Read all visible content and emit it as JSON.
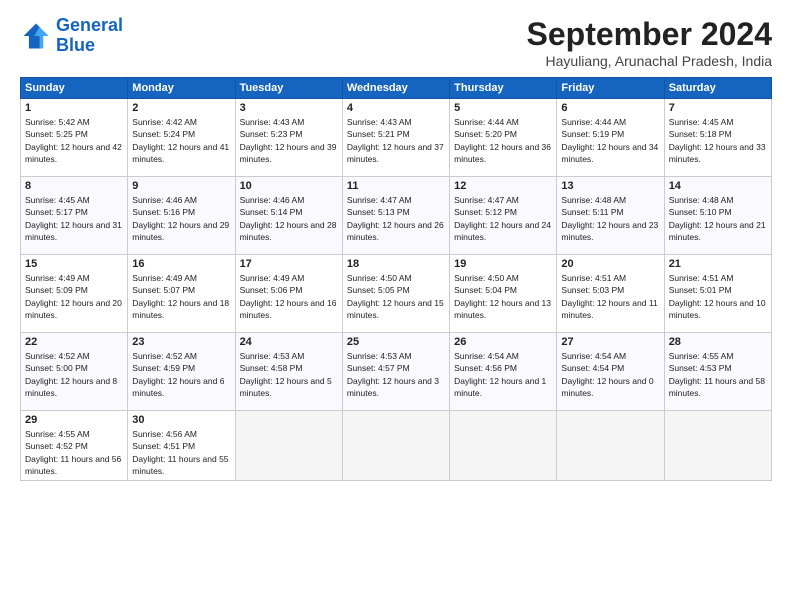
{
  "logo": {
    "line1": "General",
    "line2": "Blue"
  },
  "title": "September 2024",
  "location": "Hayuliang, Arunachal Pradesh, India",
  "days_of_week": [
    "Sunday",
    "Monday",
    "Tuesday",
    "Wednesday",
    "Thursday",
    "Friday",
    "Saturday"
  ],
  "weeks": [
    [
      {
        "num": "1",
        "sunrise": "5:42 AM",
        "sunset": "5:25 PM",
        "daylight": "12 hours and 42 minutes."
      },
      {
        "num": "2",
        "sunrise": "4:42 AM",
        "sunset": "5:24 PM",
        "daylight": "12 hours and 41 minutes."
      },
      {
        "num": "3",
        "sunrise": "4:43 AM",
        "sunset": "5:23 PM",
        "daylight": "12 hours and 39 minutes."
      },
      {
        "num": "4",
        "sunrise": "4:43 AM",
        "sunset": "5:21 PM",
        "daylight": "12 hours and 37 minutes."
      },
      {
        "num": "5",
        "sunrise": "4:44 AM",
        "sunset": "5:20 PM",
        "daylight": "12 hours and 36 minutes."
      },
      {
        "num": "6",
        "sunrise": "4:44 AM",
        "sunset": "5:19 PM",
        "daylight": "12 hours and 34 minutes."
      },
      {
        "num": "7",
        "sunrise": "4:45 AM",
        "sunset": "5:18 PM",
        "daylight": "12 hours and 33 minutes."
      }
    ],
    [
      {
        "num": "8",
        "sunrise": "4:45 AM",
        "sunset": "5:17 PM",
        "daylight": "12 hours and 31 minutes."
      },
      {
        "num": "9",
        "sunrise": "4:46 AM",
        "sunset": "5:16 PM",
        "daylight": "12 hours and 29 minutes."
      },
      {
        "num": "10",
        "sunrise": "4:46 AM",
        "sunset": "5:14 PM",
        "daylight": "12 hours and 28 minutes."
      },
      {
        "num": "11",
        "sunrise": "4:47 AM",
        "sunset": "5:13 PM",
        "daylight": "12 hours and 26 minutes."
      },
      {
        "num": "12",
        "sunrise": "4:47 AM",
        "sunset": "5:12 PM",
        "daylight": "12 hours and 24 minutes."
      },
      {
        "num": "13",
        "sunrise": "4:48 AM",
        "sunset": "5:11 PM",
        "daylight": "12 hours and 23 minutes."
      },
      {
        "num": "14",
        "sunrise": "4:48 AM",
        "sunset": "5:10 PM",
        "daylight": "12 hours and 21 minutes."
      }
    ],
    [
      {
        "num": "15",
        "sunrise": "4:49 AM",
        "sunset": "5:09 PM",
        "daylight": "12 hours and 20 minutes."
      },
      {
        "num": "16",
        "sunrise": "4:49 AM",
        "sunset": "5:07 PM",
        "daylight": "12 hours and 18 minutes."
      },
      {
        "num": "17",
        "sunrise": "4:49 AM",
        "sunset": "5:06 PM",
        "daylight": "12 hours and 16 minutes."
      },
      {
        "num": "18",
        "sunrise": "4:50 AM",
        "sunset": "5:05 PM",
        "daylight": "12 hours and 15 minutes."
      },
      {
        "num": "19",
        "sunrise": "4:50 AM",
        "sunset": "5:04 PM",
        "daylight": "12 hours and 13 minutes."
      },
      {
        "num": "20",
        "sunrise": "4:51 AM",
        "sunset": "5:03 PM",
        "daylight": "12 hours and 11 minutes."
      },
      {
        "num": "21",
        "sunrise": "4:51 AM",
        "sunset": "5:01 PM",
        "daylight": "12 hours and 10 minutes."
      }
    ],
    [
      {
        "num": "22",
        "sunrise": "4:52 AM",
        "sunset": "5:00 PM",
        "daylight": "12 hours and 8 minutes."
      },
      {
        "num": "23",
        "sunrise": "4:52 AM",
        "sunset": "4:59 PM",
        "daylight": "12 hours and 6 minutes."
      },
      {
        "num": "24",
        "sunrise": "4:53 AM",
        "sunset": "4:58 PM",
        "daylight": "12 hours and 5 minutes."
      },
      {
        "num": "25",
        "sunrise": "4:53 AM",
        "sunset": "4:57 PM",
        "daylight": "12 hours and 3 minutes."
      },
      {
        "num": "26",
        "sunrise": "4:54 AM",
        "sunset": "4:56 PM",
        "daylight": "12 hours and 1 minute."
      },
      {
        "num": "27",
        "sunrise": "4:54 AM",
        "sunset": "4:54 PM",
        "daylight": "12 hours and 0 minutes."
      },
      {
        "num": "28",
        "sunrise": "4:55 AM",
        "sunset": "4:53 PM",
        "daylight": "11 hours and 58 minutes."
      }
    ],
    [
      {
        "num": "29",
        "sunrise": "4:55 AM",
        "sunset": "4:52 PM",
        "daylight": "11 hours and 56 minutes."
      },
      {
        "num": "30",
        "sunrise": "4:56 AM",
        "sunset": "4:51 PM",
        "daylight": "11 hours and 55 minutes."
      },
      null,
      null,
      null,
      null,
      null
    ]
  ]
}
